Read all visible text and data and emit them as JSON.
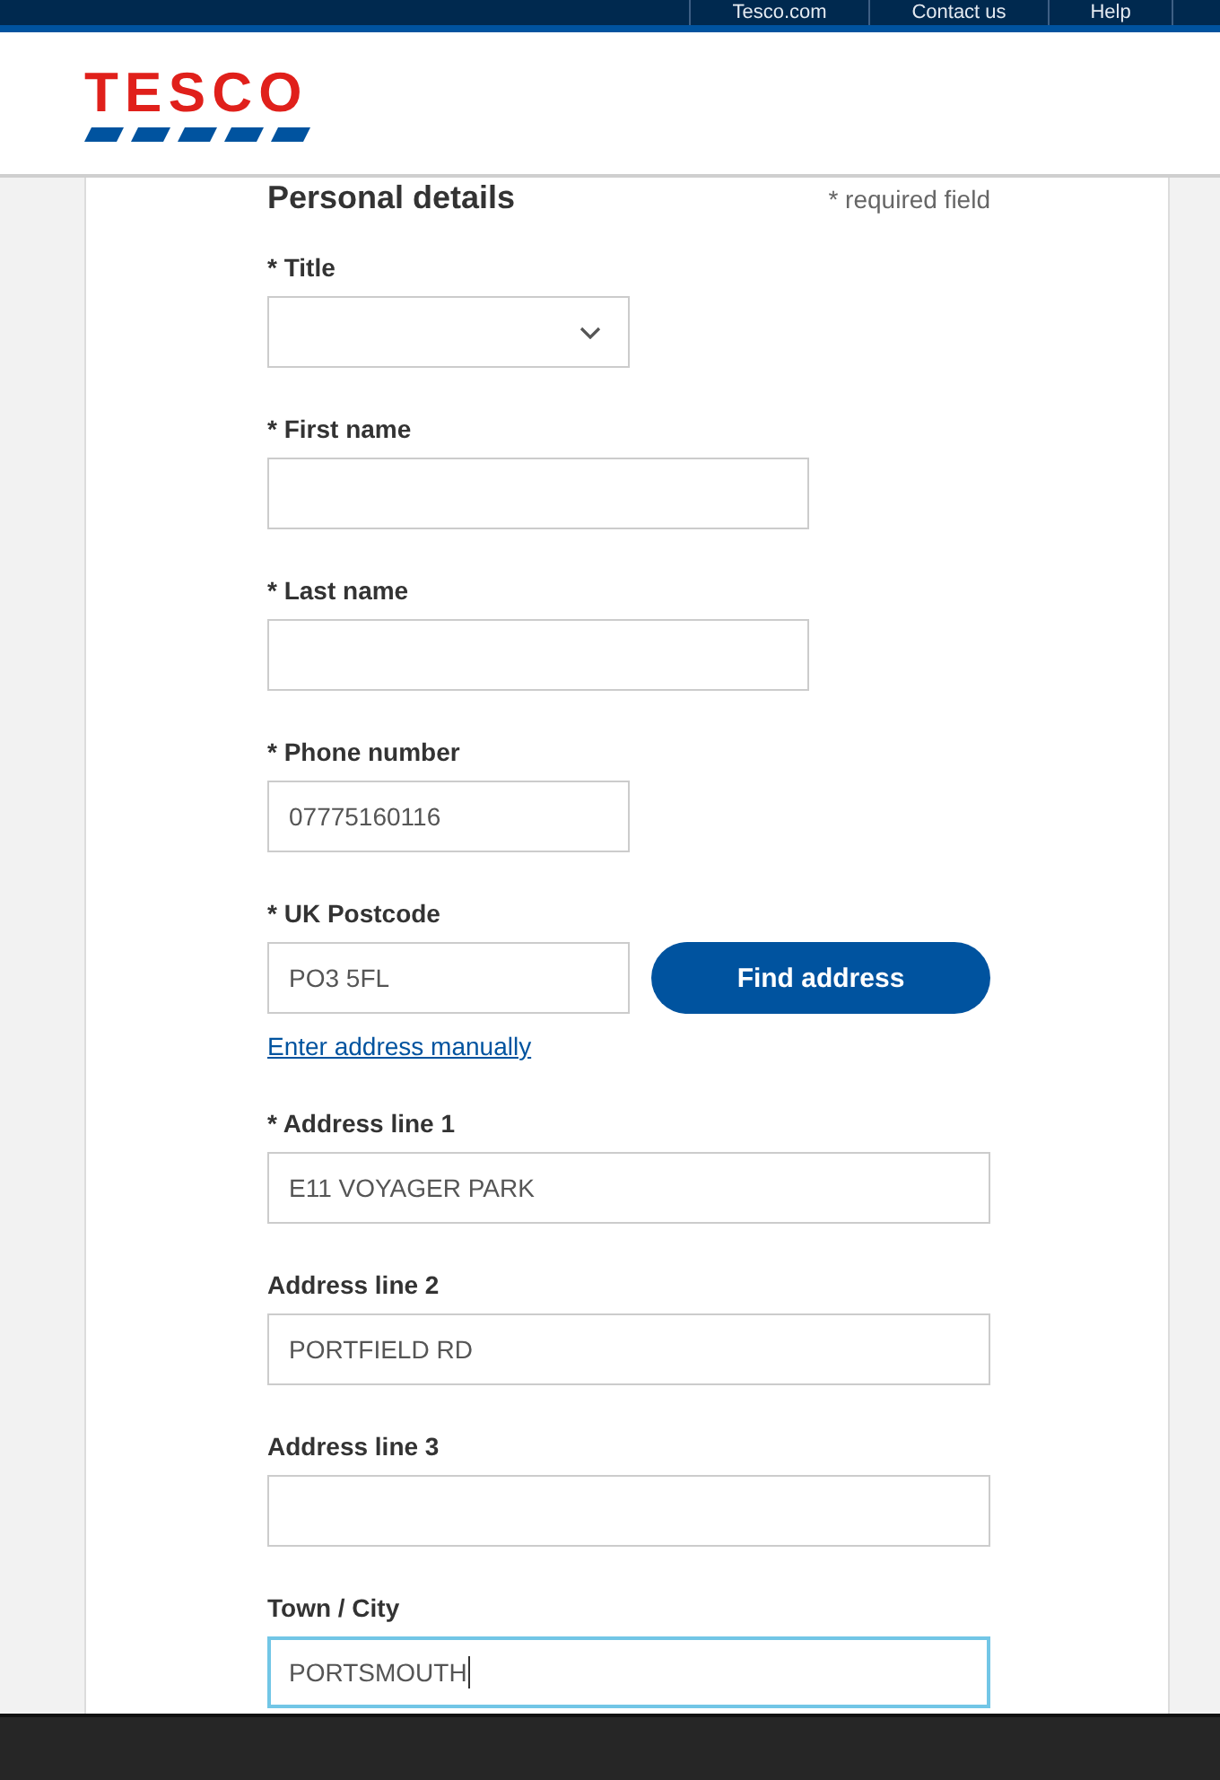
{
  "top_nav": {
    "links": [
      {
        "label": "Tesco.com"
      },
      {
        "label": "Contact us"
      },
      {
        "label": "Help"
      }
    ]
  },
  "header": {
    "logo": "TESCO"
  },
  "form": {
    "heading": "Personal details",
    "required_note": "* required field",
    "fields": [
      {
        "kind": "select",
        "label": "* Title",
        "focused": false
      },
      {
        "kind": "name",
        "label": "* First name",
        "focused": false
      },
      {
        "kind": "name",
        "label": "* Last name",
        "focused": false
      },
      {
        "kind": "phone",
        "label": "* Phone number",
        "value": "07775160116",
        "focused": false
      },
      {
        "kind": "postcode",
        "label": "* UK Postcode",
        "value": "PO3 5FL",
        "button": "Find address",
        "link": "Enter address manually",
        "focused": false
      },
      {
        "kind": "address",
        "label": "* Address line 1",
        "value": "E11 VOYAGER PARK",
        "focused": false
      },
      {
        "kind": "address",
        "label": "Address line 2",
        "value": "PORTFIELD RD",
        "focused": false
      },
      {
        "kind": "address",
        "label": "Address line 3",
        "focused": false
      },
      {
        "kind": "address",
        "label": "Town / City",
        "value": "PORTSMOUTH",
        "focused": true
      }
    ]
  }
}
